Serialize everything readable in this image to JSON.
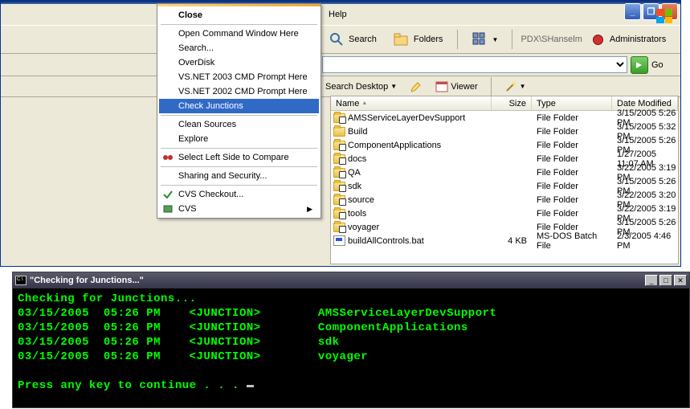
{
  "explorer": {
    "menubar": [
      "Help"
    ],
    "toolbar": {
      "search": "Search",
      "folders": "Folders",
      "user": "PDX\\SHanselm",
      "admins": "Administrators",
      "admins_color": "#d03030"
    },
    "addrbar": {
      "go": "Go"
    },
    "subbar": {
      "search_desktop": "Search Desktop",
      "viewer": "Viewer"
    },
    "columns": {
      "name": "Name",
      "size": "Size",
      "type": "Type",
      "date": "Date Modified"
    },
    "rows": [
      {
        "name": "AMSServiceLayerDevSupport",
        "size": "",
        "type": "File Folder",
        "date": "3/15/2005 5:26 PM",
        "icon": "folder-junction"
      },
      {
        "name": "Build",
        "size": "",
        "type": "File Folder",
        "date": "3/15/2005 5:32 PM",
        "icon": "folder"
      },
      {
        "name": "ComponentApplications",
        "size": "",
        "type": "File Folder",
        "date": "3/15/2005 5:26 PM",
        "icon": "folder-junction"
      },
      {
        "name": "docs",
        "size": "",
        "type": "File Folder",
        "date": "1/27/2005 11:07 AM",
        "icon": "folder-junction"
      },
      {
        "name": "QA",
        "size": "",
        "type": "File Folder",
        "date": "3/22/2005 3:19 PM",
        "icon": "folder-junction"
      },
      {
        "name": "sdk",
        "size": "",
        "type": "File Folder",
        "date": "3/15/2005 5:26 PM",
        "icon": "folder-junction"
      },
      {
        "name": "source",
        "size": "",
        "type": "File Folder",
        "date": "3/22/2005 3:20 PM",
        "icon": "folder-junction"
      },
      {
        "name": "tools",
        "size": "",
        "type": "File Folder",
        "date": "3/22/2005 3:19 PM",
        "icon": "folder-junction"
      },
      {
        "name": "voyager",
        "size": "",
        "type": "File Folder",
        "date": "3/15/2005 5:26 PM",
        "icon": "folder-junction"
      },
      {
        "name": "buildAllControls.bat",
        "size": "4 KB",
        "type": "MS-DOS Batch File",
        "date": "2/3/2005 4:46 PM",
        "icon": "bat"
      }
    ]
  },
  "context_menu": {
    "groups": [
      [
        {
          "label": "Close",
          "bold": true
        }
      ],
      [
        {
          "label": "Open Command Window Here"
        },
        {
          "label": "Search..."
        },
        {
          "label": "OverDisk"
        },
        {
          "label": "VS.NET 2003 CMD Prompt Here"
        },
        {
          "label": "VS.NET 2002 CMD Prompt Here"
        },
        {
          "label": "Check Junctions",
          "highlight": true
        }
      ],
      [
        {
          "label": "Clean Sources"
        },
        {
          "label": "Explore"
        }
      ],
      [
        {
          "label": "Select Left Side to Compare",
          "icon": "compare"
        }
      ],
      [
        {
          "label": "Sharing and Security..."
        }
      ],
      [
        {
          "label": "CVS Checkout...",
          "icon": "cvs-checkout"
        },
        {
          "label": "CVS",
          "icon": "cvs",
          "submenu": true
        }
      ]
    ]
  },
  "console": {
    "title": "\"Checking for Junctions...\"",
    "header": "Checking for Junctions...",
    "lines": [
      {
        "date": "03/15/2005",
        "time": "05:26 PM",
        "tag": "<JUNCTION>",
        "name": "AMSServiceLayerDevSupport"
      },
      {
        "date": "03/15/2005",
        "time": "05:26 PM",
        "tag": "<JUNCTION>",
        "name": "ComponentApplications"
      },
      {
        "date": "03/15/2005",
        "time": "05:26 PM",
        "tag": "<JUNCTION>",
        "name": "sdk"
      },
      {
        "date": "03/15/2005",
        "time": "05:26 PM",
        "tag": "<JUNCTION>",
        "name": "voyager"
      }
    ],
    "prompt": "Press any key to continue . . . "
  }
}
